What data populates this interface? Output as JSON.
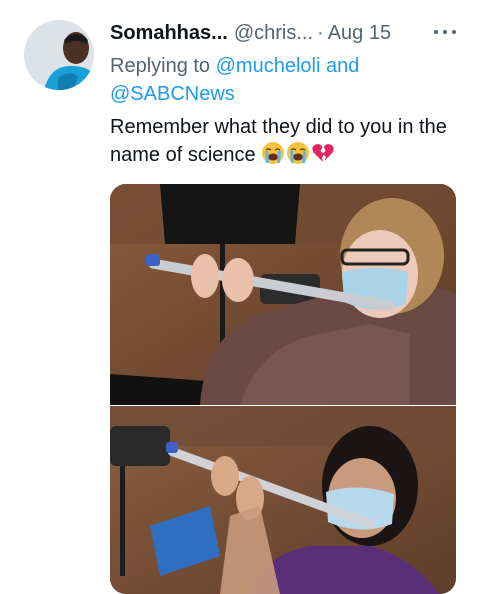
{
  "tweet": {
    "author_name": "Somahhas...",
    "author_handle": "@chris...",
    "separator": "·",
    "date": "Aug 15",
    "replying_prefix": "Replying to",
    "reply_mention_1": "@mucheloli",
    "reply_joiner": "and",
    "reply_mention_2": "@SABCNews",
    "text": "Remember what they did to you in the name of science",
    "emojis": [
      "loudly-crying-face-icon",
      "loudly-crying-face-icon",
      "broken-heart-icon"
    ]
  },
  "colors": {
    "text_primary": "#0f1419",
    "text_secondary": "#536471",
    "link": "#1d9bf0"
  }
}
